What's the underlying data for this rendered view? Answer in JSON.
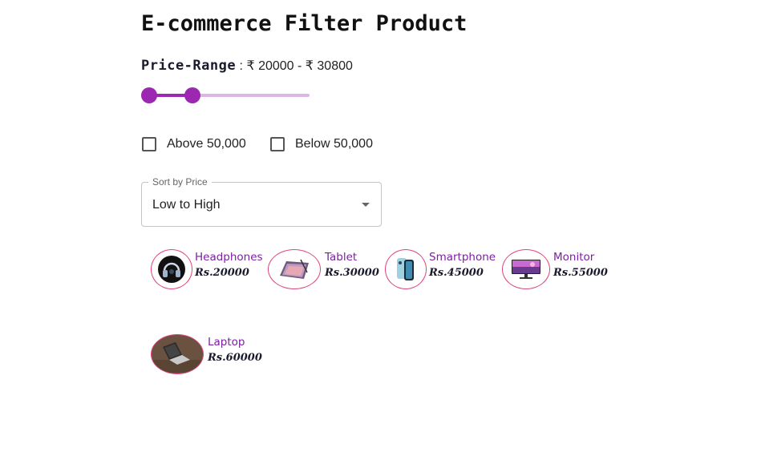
{
  "title": "E-commerce Filter Product",
  "price_range": {
    "label": "Price-Range",
    "separator": " : ",
    "value_text": "₹ 20000 - ₹ 30800",
    "min_fraction": 0.0,
    "max_fraction": 0.27,
    "accent_color": "#9c27b0",
    "rail_color": "#dcb6e2"
  },
  "filters": {
    "above": {
      "label": "Above 50,000",
      "checked": false
    },
    "below": {
      "label": "Below 50,000",
      "checked": false
    }
  },
  "sort": {
    "legend": "Sort by Price",
    "selected": "Low to High",
    "icon": "caret-down-icon"
  },
  "products": [
    {
      "name": "Headphones",
      "price": "Rs.20000",
      "icon": "headphones-icon"
    },
    {
      "name": "Tablet",
      "price": "Rs.30000",
      "icon": "tablet-icon"
    },
    {
      "name": "Smartphone",
      "price": "Rs.45000",
      "icon": "smartphone-icon"
    },
    {
      "name": "Monitor",
      "price": "Rs.55000",
      "icon": "monitor-icon"
    },
    {
      "name": "Laptop",
      "price": "Rs.60000",
      "icon": "laptop-icon"
    }
  ],
  "colors": {
    "product_name": "#7b1fa2",
    "product_border": "#e0447a"
  }
}
